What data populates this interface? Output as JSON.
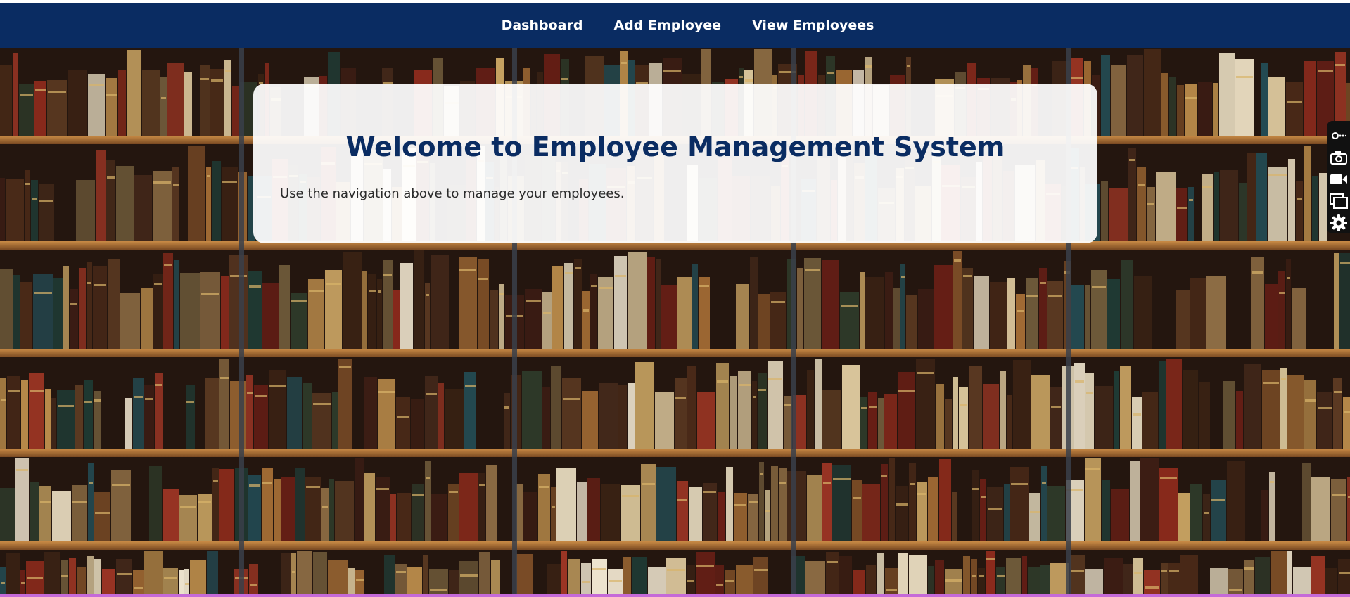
{
  "nav": {
    "links": [
      "Dashboard",
      "Add Employee",
      "View Employees"
    ]
  },
  "hero": {
    "title": "Welcome to Employee Management System",
    "subtitle": "Use the navigation above to manage your employees.",
    "background": "library-bookshelf-photo"
  },
  "side_toolbar": {
    "icons": [
      "link-icon",
      "camera-icon",
      "video-camera-icon",
      "window-icon",
      "gear-icon"
    ]
  },
  "colors": {
    "navbar": "#0a2c62",
    "title": "#0a2c62",
    "card": "#ffffff",
    "toolbar": "#111111",
    "bottom_edge": "#c56ad8"
  }
}
